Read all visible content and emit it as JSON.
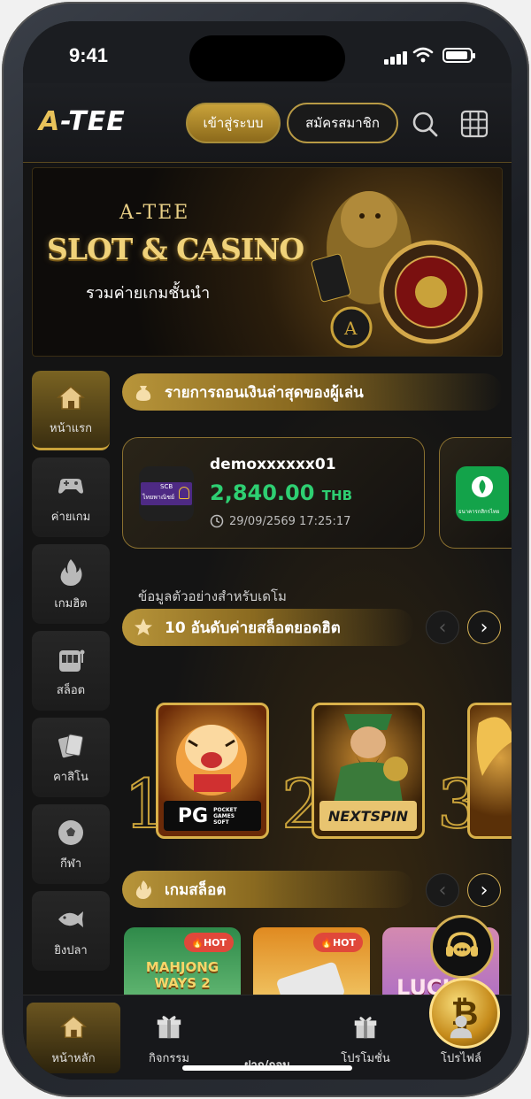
{
  "status_bar": {
    "time": "9:41"
  },
  "header": {
    "logo_prefix": "A",
    "logo_suffix": "-TEE",
    "login_label": "เข้าสู่ระบบ",
    "register_label": "สมัครสมาชิก",
    "search_icon": "search-icon",
    "menu_icon": "grid-icon"
  },
  "banner": {
    "brand": "A-TEE",
    "title": "SLOT & CASINO",
    "subtitle": "รวมค่ายเกมชั้นนำ"
  },
  "sidebar": {
    "items": [
      {
        "label": "หน้าแรก",
        "icon": "home-icon",
        "active": true
      },
      {
        "label": "ค่ายเกม",
        "icon": "gamepad-icon"
      },
      {
        "label": "เกมฮิต",
        "icon": "fire-icon"
      },
      {
        "label": "สล็อต",
        "icon": "slot-machine-icon"
      },
      {
        "label": "คาสิโน",
        "icon": "cards-icon"
      },
      {
        "label": "กีฬา",
        "icon": "football-icon"
      },
      {
        "label": "ยิงปลา",
        "icon": "fish-icon"
      }
    ]
  },
  "withdrawals": {
    "title": "รายการถอนเงินล่าสุดของผู้เล่น",
    "items": [
      {
        "bank": "SCB",
        "bank_name_th": "ไทยพาณิชย์",
        "user": "demoxxxxxx01",
        "amount": "2,840.00",
        "currency": "THB",
        "datetime": "29/09/2569 17:25:17"
      },
      {
        "bank": "KBANK",
        "bank_name_th": "ธนาคารกสิกรไทย"
      }
    ]
  },
  "demo_note": "ข้อมูลตัวอย่างสำหรับเดโม",
  "top_providers": {
    "title": "10 อันดับค่ายสล็อตยอดฮิต",
    "items": [
      {
        "rank": "1",
        "name": "PG",
        "tagline": "POCKET GAMES SOFT"
      },
      {
        "rank": "2",
        "name": "NEXTSPIN"
      },
      {
        "rank": "3",
        "name": ""
      }
    ]
  },
  "slot_games": {
    "title": "เกมสล็อต",
    "items": [
      {
        "name": "MAHJONG WAYS 2",
        "badge": "HOT"
      },
      {
        "name": "",
        "badge": "HOT"
      },
      {
        "name": "LUCKY",
        "badge": ""
      }
    ]
  },
  "bottom_nav": {
    "items": [
      {
        "label": "หน้าหลัก",
        "icon": "home-icon",
        "active": true
      },
      {
        "label": "กิจกรรม",
        "icon": "gift-icon"
      },
      {
        "label": "ฝาก/ถอน",
        "icon": "bitcoin-coin-icon"
      },
      {
        "label": "โปรโมชั่น",
        "icon": "promo-gift-icon"
      },
      {
        "label": "โปรไฟล์",
        "icon": "user-icon"
      }
    ]
  },
  "colors": {
    "gold": "#c9a23a",
    "green": "#2ecf72",
    "bg": "#141414"
  }
}
